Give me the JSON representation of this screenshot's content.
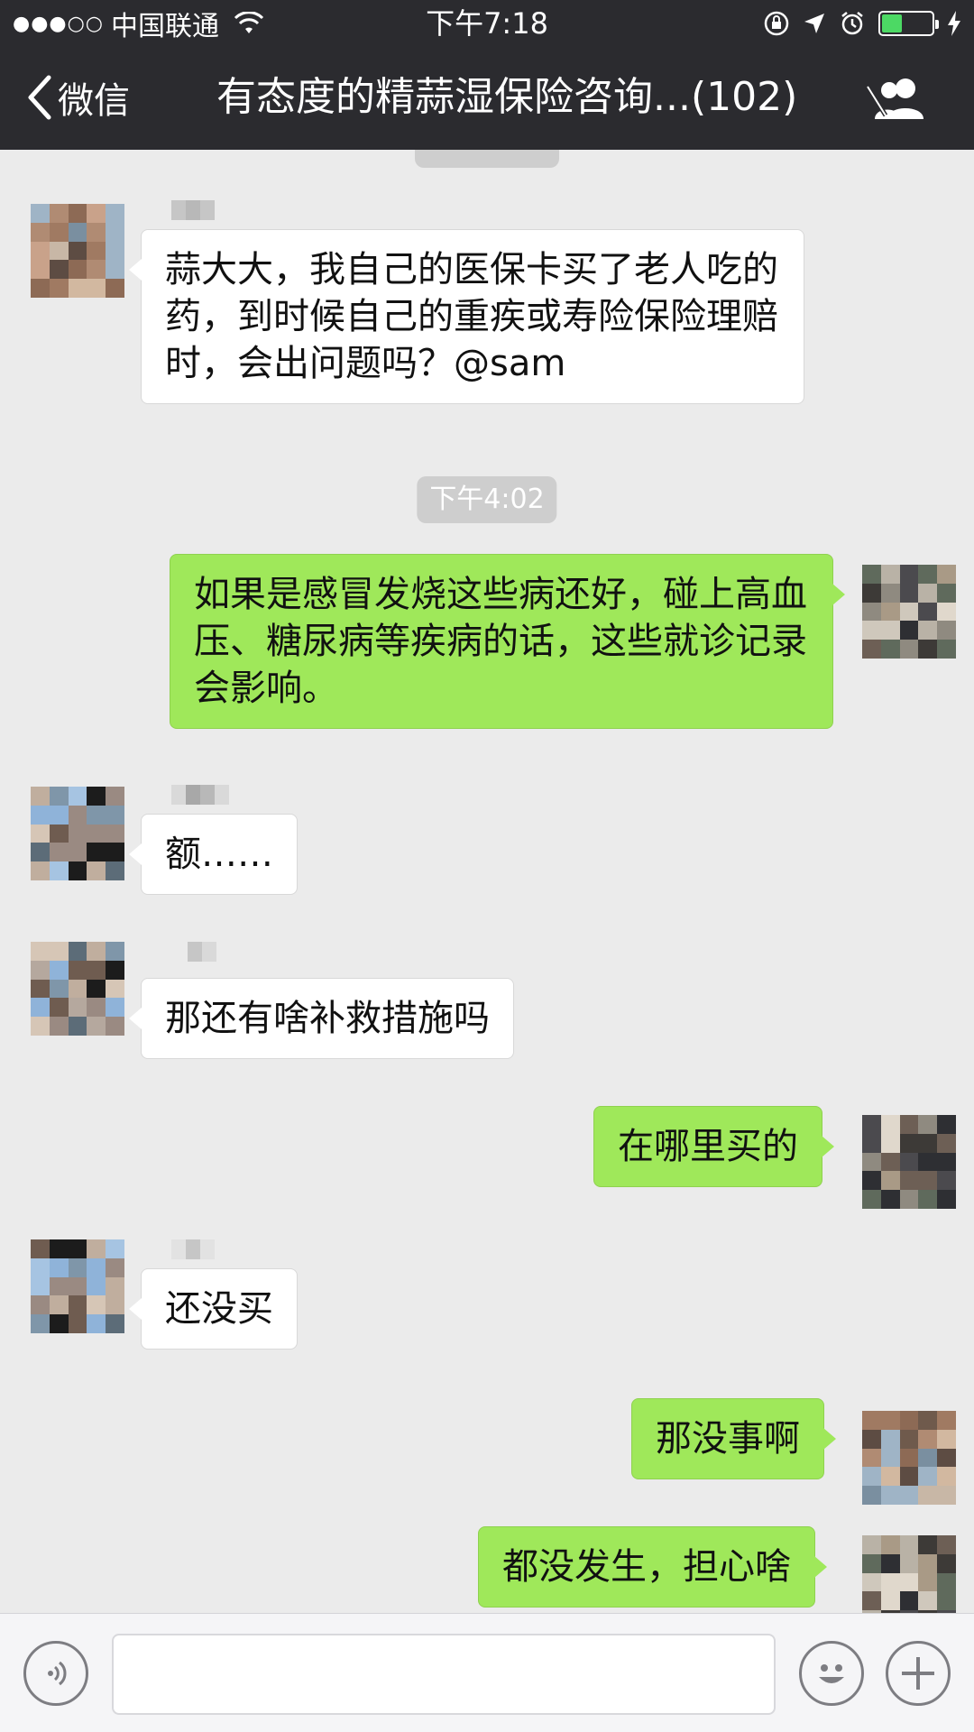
{
  "status_bar": {
    "signal": "●●●○○",
    "carrier": "中国联通",
    "time": "下午7:18"
  },
  "nav": {
    "back_label": "微信",
    "title": "有态度的精蒜湿保险咨询...(102)"
  },
  "chat": {
    "timestamp": "下午4:02",
    "messages": [
      {
        "side": "in",
        "text": "蒜大大，我自己的医保卡买了老人吃的药，到时候自己的重疾或寿险保险理赔时，会出问题吗？@sam"
      },
      {
        "side": "out",
        "text": "如果是感冒发烧这些病还好，碰上高血压、糖尿病等疾病的话，这些就诊记录会影响。"
      },
      {
        "side": "in",
        "text": "额……"
      },
      {
        "side": "in",
        "text": "那还有啥补救措施吗"
      },
      {
        "side": "out",
        "text": "在哪里买的"
      },
      {
        "side": "in",
        "text": "还没买"
      },
      {
        "side": "out",
        "text": "那没事啊"
      },
      {
        "side": "out",
        "text": "都没发生，担心啥"
      }
    ]
  },
  "colors": {
    "header_bg": "#2b2b2f",
    "chat_bg": "#ebebeb",
    "outgoing_bubble": "#9fe85a",
    "incoming_bubble": "#ffffff",
    "battery": "#4cd964"
  },
  "icons": {
    "back": "chevron-left-icon",
    "group": "group-members-icon",
    "mute": "mute-icon",
    "voice": "voice-icon",
    "emoji": "emoji-icon",
    "plus": "plus-icon"
  },
  "battery_level": 0.4
}
